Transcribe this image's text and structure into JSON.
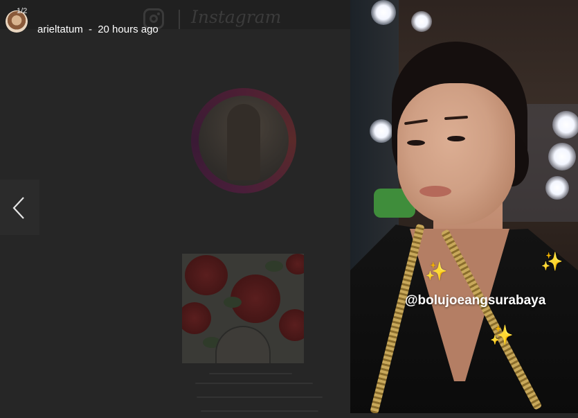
{
  "background_page": {
    "brand_wordmark": "Instagram"
  },
  "story": {
    "header": {
      "count": "1/2",
      "username": "arieltatum",
      "separator": "-",
      "time_ago": "20 hours ago"
    },
    "mention": "@bolujoeangsurabaya",
    "stickers": [
      {
        "icon": "sparkles-icon"
      },
      {
        "icon": "sparkles-icon"
      },
      {
        "icon": "sparkles-icon"
      }
    ]
  },
  "navigation": {
    "previous_icon": "chevron-left-icon"
  }
}
